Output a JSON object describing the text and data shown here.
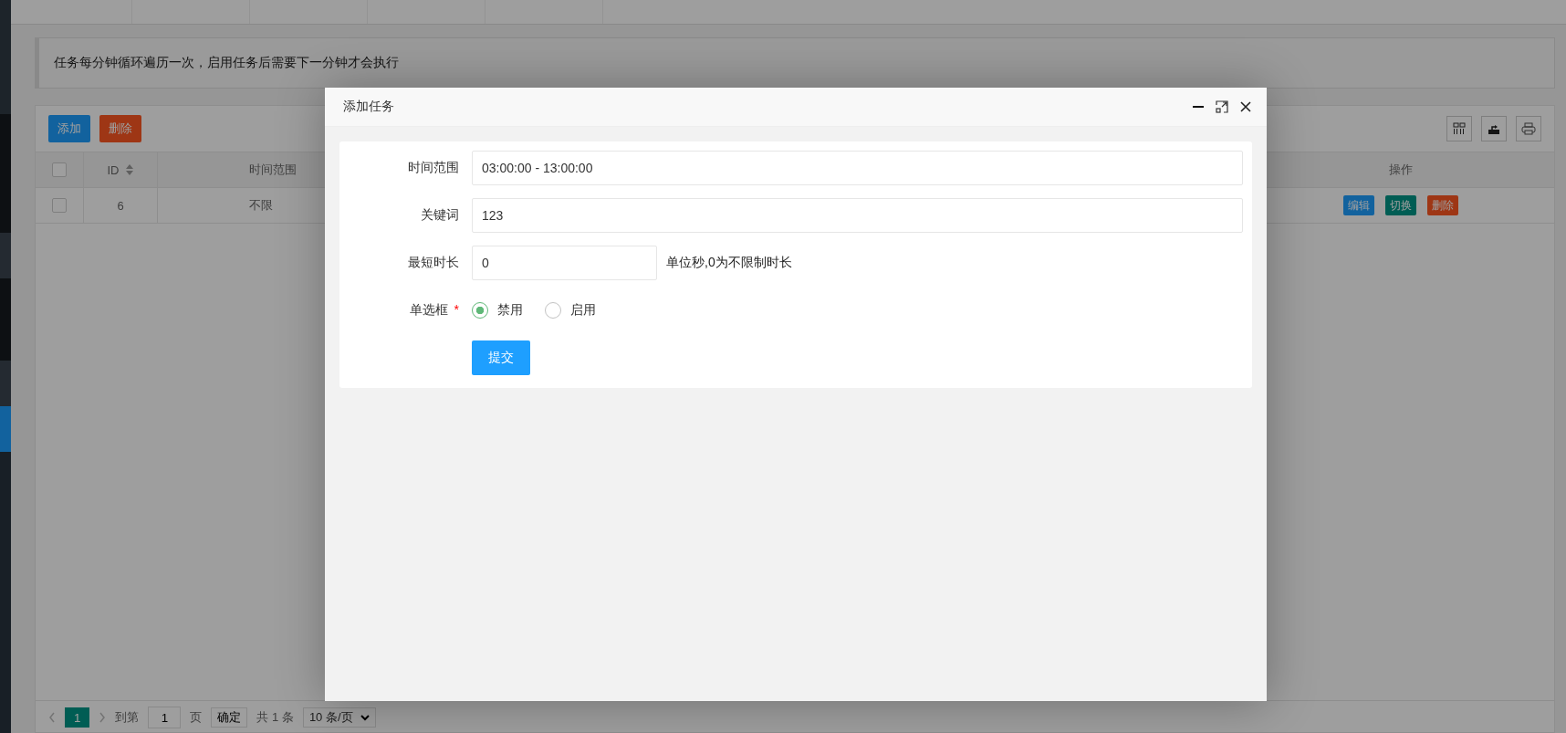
{
  "notice": "任务每分钟循环遍历一次，启用任务后需要下一分钟才会执行",
  "toolbar": {
    "buttons": [
      {
        "label": "添加",
        "kind": "add"
      },
      {
        "label": "删除",
        "kind": "delete"
      }
    ],
    "tools": [
      {
        "kind": "columns"
      },
      {
        "kind": "export"
      },
      {
        "kind": "print"
      }
    ]
  },
  "table": {
    "columns": [
      {
        "kind": "checkbox",
        "checked": false
      },
      {
        "kind": "text",
        "label": "ID",
        "sortable": true
      },
      {
        "kind": "text",
        "label": "时间范围"
      },
      {
        "kind": "actions",
        "label": "操作"
      }
    ],
    "rows": [
      {
        "checked": false,
        "id": "6",
        "time_range": "不限",
        "actions": [
          {
            "label": "编辑",
            "kind": "edit"
          },
          {
            "label": "切换",
            "kind": "toggle"
          },
          {
            "label": "删除",
            "kind": "delete"
          }
        ]
      }
    ]
  },
  "pagination": {
    "pages": [
      {
        "label": "1",
        "selected": true
      }
    ],
    "goto_label": "到第",
    "goto_value": "1",
    "page_unit": "页",
    "confirm": "确定",
    "total": "共 1 条",
    "page_size": "10 条/页"
  },
  "dialog": {
    "title": "添加任务",
    "fields": [
      {
        "kind": "text",
        "label": "时间范围",
        "value": "03:00:00 - 13:00:00"
      },
      {
        "kind": "text",
        "label": "关键词",
        "value": "123"
      },
      {
        "kind": "short",
        "label": "最短时长",
        "value": "0",
        "hint": "单位秒,0为不限制时长"
      },
      {
        "kind": "radio",
        "label": "单选框",
        "required_mark": "*",
        "options": [
          {
            "label": "禁用",
            "selected": true
          },
          {
            "label": "启用",
            "selected": false
          }
        ]
      }
    ],
    "submit": "提交"
  }
}
